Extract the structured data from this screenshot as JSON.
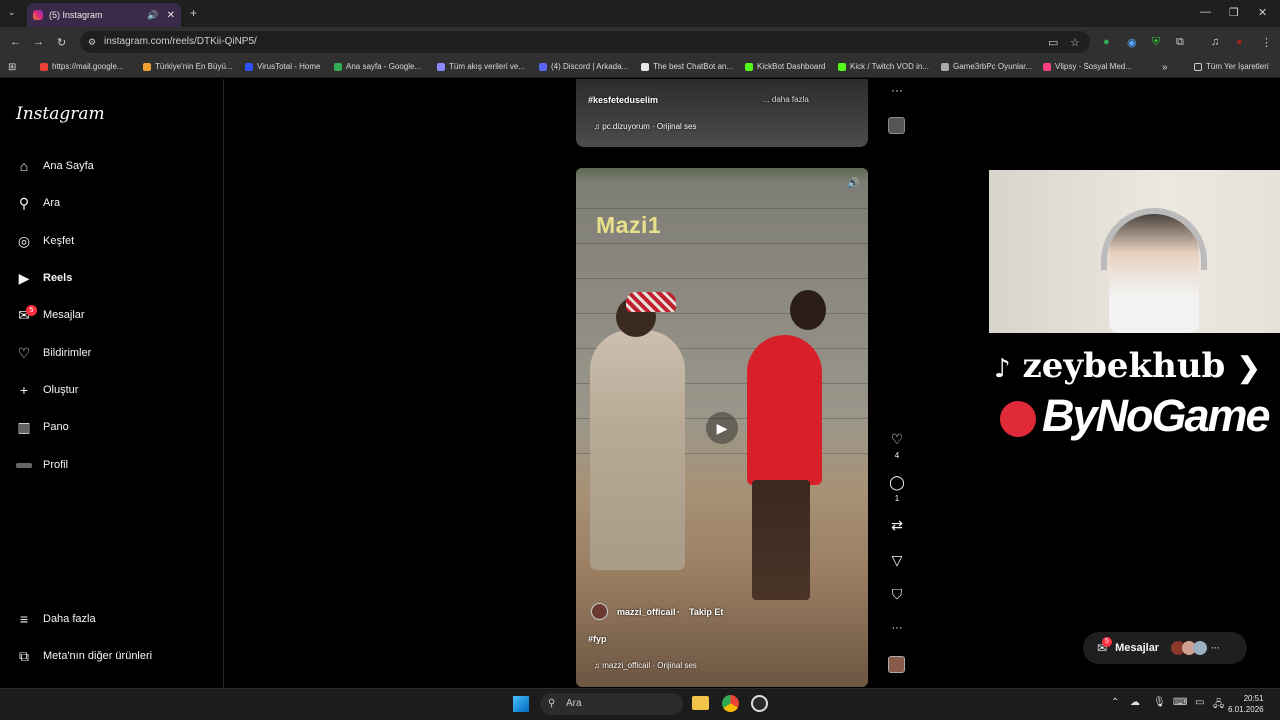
{
  "browser": {
    "tab_title": "(5) Instagram",
    "url": "instagram.com/reels/DTKii-QiNP5/",
    "bookmarks": [
      {
        "label": "https://mail.google...",
        "color": "#ea4335"
      },
      {
        "label": "Türkiye'nin En Büyü...",
        "color": "#f0a030"
      },
      {
        "label": "VirusTotal - Home",
        "color": "#3050ff"
      },
      {
        "label": "Ana sayfa - Google...",
        "color": "#34a853"
      },
      {
        "label": "Tüm akış verileri ve...",
        "color": "#8888ff"
      },
      {
        "label": "(4) Discord | Arkada...",
        "color": "#5865f2"
      },
      {
        "label": "The best ChatBot an...",
        "color": "#e8e8e8"
      },
      {
        "label": "KickBot Dashboard",
        "color": "#53fc18"
      },
      {
        "label": "Kick / Twitch VOD in...",
        "color": "#53fc18"
      },
      {
        "label": "Game3rbPc Oyunlar...",
        "color": "#aaaaaa"
      },
      {
        "label": "Vlipsy - Sosyal Med...",
        "color": "#ff4081"
      }
    ],
    "all_bookmarks": "Tüm Yer İşaretleri"
  },
  "sidebar": {
    "logo": "Instagram",
    "items": [
      {
        "label": "Ana Sayfa",
        "icon": "home-icon",
        "glyph": "⌂"
      },
      {
        "label": "Ara",
        "icon": "search-icon",
        "glyph": "⚲"
      },
      {
        "label": "Keşfet",
        "icon": "compass-icon",
        "glyph": "◎"
      },
      {
        "label": "Reels",
        "icon": "reels-icon",
        "glyph": "▶"
      },
      {
        "label": "Mesajlar",
        "icon": "messenger-icon",
        "glyph": "✉",
        "badge": "5"
      },
      {
        "label": "Bildirimler",
        "icon": "heart-icon",
        "glyph": "♡"
      },
      {
        "label": "Oluştur",
        "icon": "plus-icon",
        "glyph": "+"
      },
      {
        "label": "Pano",
        "icon": "dashboard-icon",
        "glyph": "▥"
      },
      {
        "label": "Profil",
        "icon": "avatar",
        "glyph": "•"
      }
    ],
    "more": "Daha fazla",
    "meta": "Meta'nın diğer ürünleri"
  },
  "prev_reel": {
    "caption_tag": "#kesfeteduselim",
    "caption_more": "... daha fazla",
    "audio": "pc.dizuyorum · Orijinal ses"
  },
  "reel": {
    "overlay_text": "Mazi1",
    "username": "mazzi_officail",
    "follow": "Takip Et",
    "caption": "#fyp",
    "audio": "mazzi_officail · Orijinal ses",
    "likes": "4",
    "comments": "1"
  },
  "stream_overlay": {
    "tiktok": "zeybekhub",
    "brand": "ByNoGame"
  },
  "messages_pill": {
    "label": "Mesajlar",
    "badge": "5"
  },
  "taskbar": {
    "search": "Ara",
    "time": "20:51",
    "date": "6.01.2026"
  }
}
